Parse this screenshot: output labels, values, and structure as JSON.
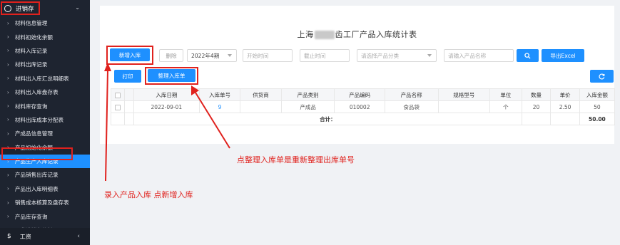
{
  "sidebar": {
    "module": "进销存",
    "items": [
      "材料信息管理",
      "材料初始化余额",
      "材料入库记录",
      "材料出库记录",
      "材料出入库汇总明细表",
      "材料出入库盘存表",
      "材料库存查询",
      "材料出库成本分配表",
      "产成品信息管理",
      "产品初始化余额",
      "产品生产入库记录",
      "产品销售出库记录",
      "产品出入库明细表",
      "销售成本核算及盘存表",
      "产品库存查询",
      "工业进销存分析"
    ],
    "active_index": 10,
    "bottom_label": "工资"
  },
  "page": {
    "title_left": "上海",
    "title_right": "齿工厂产品入库统计表"
  },
  "toolbar": {
    "add_label": "新增入库",
    "delete_label": "删除",
    "period_value": "2022年4期",
    "start_placeholder": "开始时间",
    "end_placeholder": "截止时间",
    "category_placeholder": "请选择产品分类",
    "name_placeholder": "请输入产品名称",
    "export_label": "导出Excel",
    "print_label": "打印",
    "reorg_label": "整理入库单"
  },
  "table": {
    "headers": [
      "入库日期",
      "入库单号",
      "供货商",
      "产品类别",
      "产品编码",
      "产品名称",
      "规格型号",
      "单位",
      "数量",
      "单价",
      "入库金额"
    ],
    "rows": [
      {
        "date": "2022-09-01",
        "no": "9",
        "supplier": "",
        "category": "产成品",
        "code": "010002",
        "name": "食品袋",
        "spec": "",
        "unit": "个",
        "qty": "20",
        "price": "2.50",
        "amount": "50"
      }
    ],
    "total_label": "合计：",
    "total_amount": "50.00"
  },
  "annotations": {
    "reorg_note": "点整理入库单是重新整理出库单号",
    "add_note": "录入产品入库 点新增入库",
    "color": "#e0211d"
  },
  "colors": {
    "accent": "#1e90ff",
    "sidebar_bg": "#1e2430"
  }
}
